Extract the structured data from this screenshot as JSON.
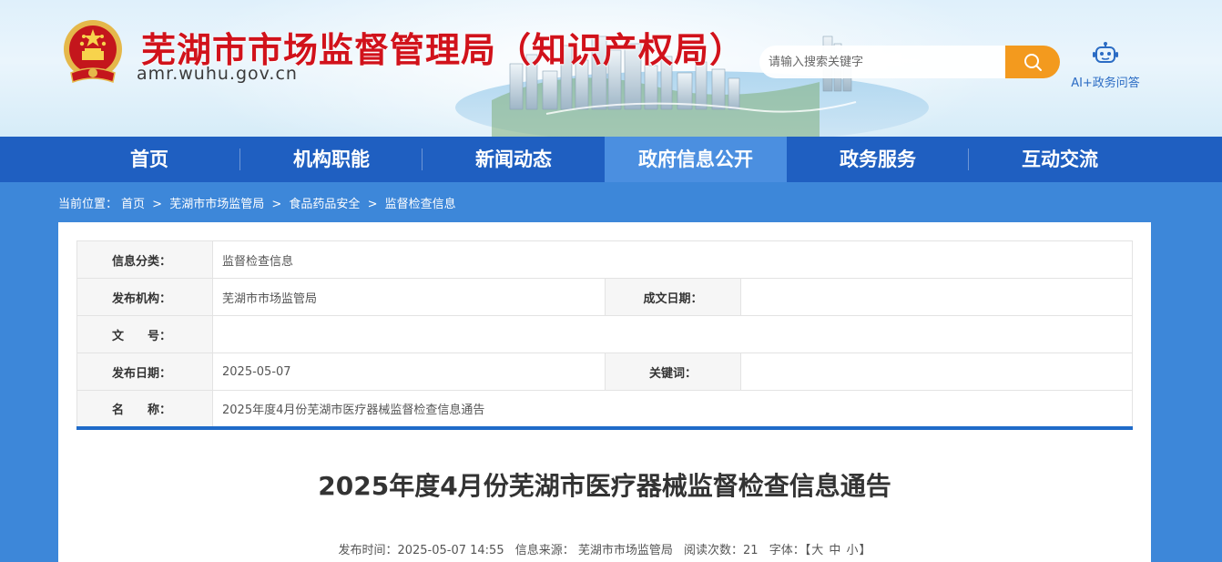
{
  "header": {
    "title": "芜湖市市场监督管理局（知识产权局）",
    "domain": "amr.wuhu.gov.cn",
    "search_placeholder": "请输入搜索关键字",
    "ai_label": "AI+政务问答",
    "icons": {
      "emblem": "national-emblem-icon",
      "search": "search-icon",
      "ai": "robot-icon"
    }
  },
  "colors": {
    "brand_red": "#d1121b",
    "nav_blue": "#1f5fc1",
    "nav_active": "#4b8fe0",
    "search_orange": "#f39a1e",
    "page_bg": "#3d87d9"
  },
  "nav": {
    "items": [
      "首页",
      "机构职能",
      "新闻动态",
      "政府信息公开",
      "政务服务",
      "互动交流"
    ],
    "active": "政府信息公开"
  },
  "breadcrumb": {
    "prefix": "当前位置：",
    "items": [
      "首页",
      "芜湖市市场监管局",
      "食品药品安全",
      "监督检查信息"
    ],
    "separator": ">"
  },
  "info": {
    "category_label": "信息分类：",
    "category_value": "监督检查信息",
    "org_label": "发布机构：",
    "org_value": "芜湖市市场监管局",
    "created_label": "成文日期：",
    "created_value": "",
    "doc_no_label": "文　　号：",
    "doc_no_value": "",
    "publish_label": "发布日期：",
    "publish_value": "2025-05-07",
    "keywords_label": "关键词：",
    "keywords_value": "",
    "name_label": "名　　称：",
    "name_value": "2025年度4月份芜湖市医疗器械监督检查信息通告"
  },
  "article": {
    "title": "2025年度4月份芜湖市医疗器械监督检查信息通告",
    "publish_time": "发布时间：2025-05-07 14:55",
    "source": "信息来源： 芜湖市市场监管局",
    "views": "阅读次数：21",
    "font_label": "字体：【",
    "font_large": "大",
    "font_medium": "中",
    "font_small": "小",
    "font_close": "】"
  }
}
